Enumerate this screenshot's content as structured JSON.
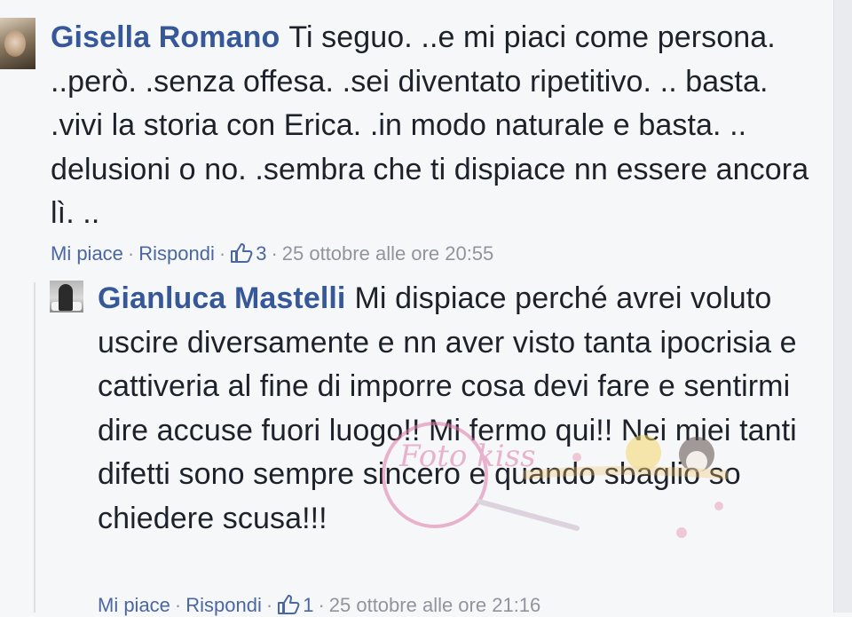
{
  "comments": [
    {
      "author": "Gisella Romano",
      "text": "Ti seguo. ..e mi piaci come persona. ..però. .senza offesa. .sei diventato ripetitivo. .. basta. .vivi la storia con Erica. .in modo naturale e basta. .. delusioni o no. .sembra che ti dispiace nn essere ancora lì. ..",
      "like_label": "Mi piace",
      "reply_label": "Rispondi",
      "likes": "3",
      "timestamp": "25 ottobre alle ore 20:55",
      "avatar_icon": "user-avatar"
    },
    {
      "author": "Gianluca Mastelli",
      "text": "Mi dispiace perché avrei voluto uscire diversamente e nn aver visto tanta ipocrisia e cattiveria al fine di imporre cosa devi fare e sentirmi dire accuse fuori luogo!! Mi fermo qui!! Nei miei tanti difetti sono sempre sincero e quando sbaglio so chiedere scusa!!!",
      "like_label": "Mi piace",
      "reply_label": "Rispondi",
      "likes": "1",
      "timestamp": "25 ottobre alle ore 21:16",
      "avatar_icon": "user-avatar"
    }
  ],
  "colors": {
    "author": "#365899",
    "meta": "#90949c",
    "link": "#4b67a1",
    "background": "#f6f7f9"
  },
  "watermark": {
    "text": "Foto kiss",
    "icon": "watermark-logo"
  }
}
